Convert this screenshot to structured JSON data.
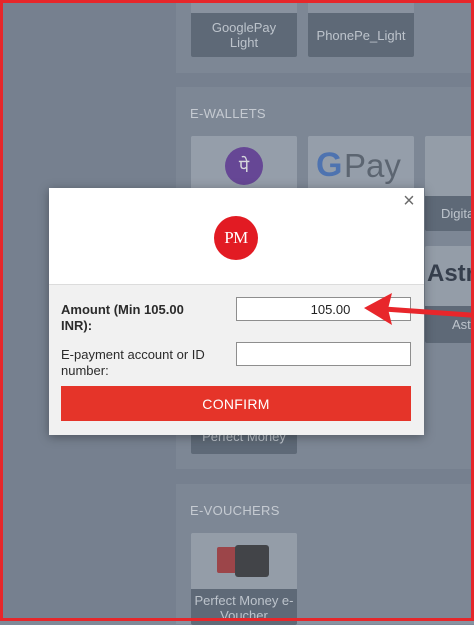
{
  "top_cards": [
    {
      "label": "GooglePay Light"
    },
    {
      "label": "PhonePe_Light"
    }
  ],
  "ewallets": {
    "title": "E-WALLETS",
    "cards": [
      {
        "label": "PhonePe",
        "logo_text": "पे"
      },
      {
        "label": "Google Pay",
        "logo_text": "Pay"
      },
      {
        "label": "Digital",
        "logo_text": "Digita"
      },
      {
        "label": "Astropay",
        "logo_text": "Astr",
        "sub": "Ast"
      },
      {
        "label": "Perfect Money"
      }
    ]
  },
  "evouchers": {
    "title": "E-VOUCHERS",
    "cards": [
      {
        "label": "Perfect Money e-Voucher"
      }
    ]
  },
  "modal": {
    "logo_text": "PM",
    "close_icon": "×",
    "amount_label": "Amount (Min 105.00 INR):",
    "amount_value": "105.00",
    "account_label": "E-payment account or ID number:",
    "account_value": "",
    "confirm_label": "CONFIRM"
  },
  "colors": {
    "accent": "#e53429",
    "logo_red": "#e21b23",
    "frame_red": "#e6262a"
  }
}
